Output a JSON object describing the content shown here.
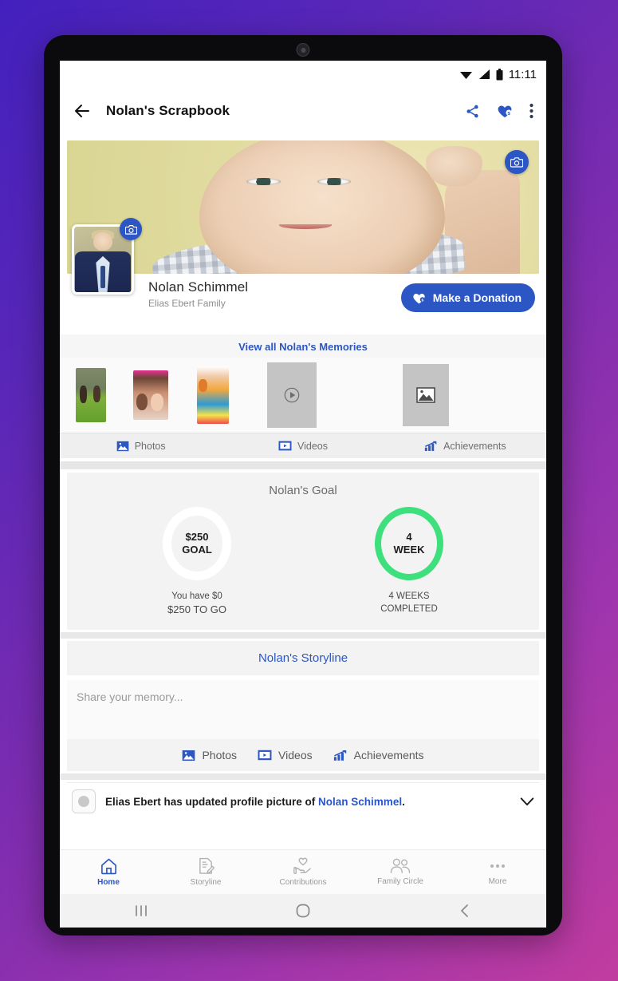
{
  "status_bar": {
    "time": "11:11",
    "icons": [
      "wifi-icon",
      "signal-icon",
      "battery-icon"
    ]
  },
  "app_bar": {
    "back_icon": "back-arrow-icon",
    "title": "Nolan's Scrapbook",
    "actions": [
      "share-icon",
      "heart-donation-icon",
      "overflow-menu-icon"
    ]
  },
  "cover": {
    "camera_button_icon": "camera-icon"
  },
  "profile": {
    "avatar_camera_icon": "camera-icon",
    "name": "Nolan Schimmel",
    "family": "Elias Ebert Family",
    "donate_button": "Make a Donation",
    "donate_icon": "heart-dollar-icon"
  },
  "memories": {
    "view_all_label": "View all Nolan's Memories",
    "video_placeholder_icon": "play-icon",
    "image_placeholder_icon": "image-icon",
    "tabs": [
      {
        "label": "Photos",
        "icon": "photo-icon"
      },
      {
        "label": "Videos",
        "icon": "video-icon"
      },
      {
        "label": "Achievements",
        "icon": "achievements-icon"
      }
    ]
  },
  "goal": {
    "title": "Nolan's Goal",
    "money_ring": {
      "value": "$250",
      "unit": "GOAL",
      "caption_line1": "You have $0",
      "caption_line2": "$250 TO GO",
      "ring_color": "#ffffff"
    },
    "week_ring": {
      "value": "4",
      "unit": "WEEK",
      "caption_line1": "4 WEEKS",
      "caption_line2": "COMPLETED",
      "ring_color": "#3ee07d"
    }
  },
  "storyline": {
    "header": "Nolan's Storyline",
    "composer_placeholder": "Share your memory...",
    "actions": [
      {
        "label": "Photos",
        "icon": "photo-icon"
      },
      {
        "label": "Videos",
        "icon": "video-icon"
      },
      {
        "label": "Achievements",
        "icon": "achievements-icon"
      }
    ]
  },
  "feed": {
    "item_prefix": "Elias Ebert has updated profile picture of ",
    "item_link": "Nolan Schimmel",
    "item_suffix": ".",
    "expand_icon": "chevron-down-icon"
  },
  "bottom_nav": {
    "items": [
      {
        "label": "Home",
        "icon": "home-icon",
        "active": true
      },
      {
        "label": "Storyline",
        "icon": "storyline-icon",
        "active": false
      },
      {
        "label": "Contributions",
        "icon": "contributions-icon",
        "active": false
      },
      {
        "label": "Family Circle",
        "icon": "family-circle-icon",
        "active": false
      },
      {
        "label": "More",
        "icon": "more-icon",
        "active": false
      }
    ]
  },
  "system_nav": {
    "recents_icon": "recents-icon",
    "home_icon": "home-circle-icon",
    "back_icon": "back-chevron-icon"
  },
  "colors": {
    "accent": "#2b56c4",
    "success": "#3ee07d",
    "background_gradient_start": "#4320bd",
    "background_gradient_end": "#c13c9f"
  }
}
